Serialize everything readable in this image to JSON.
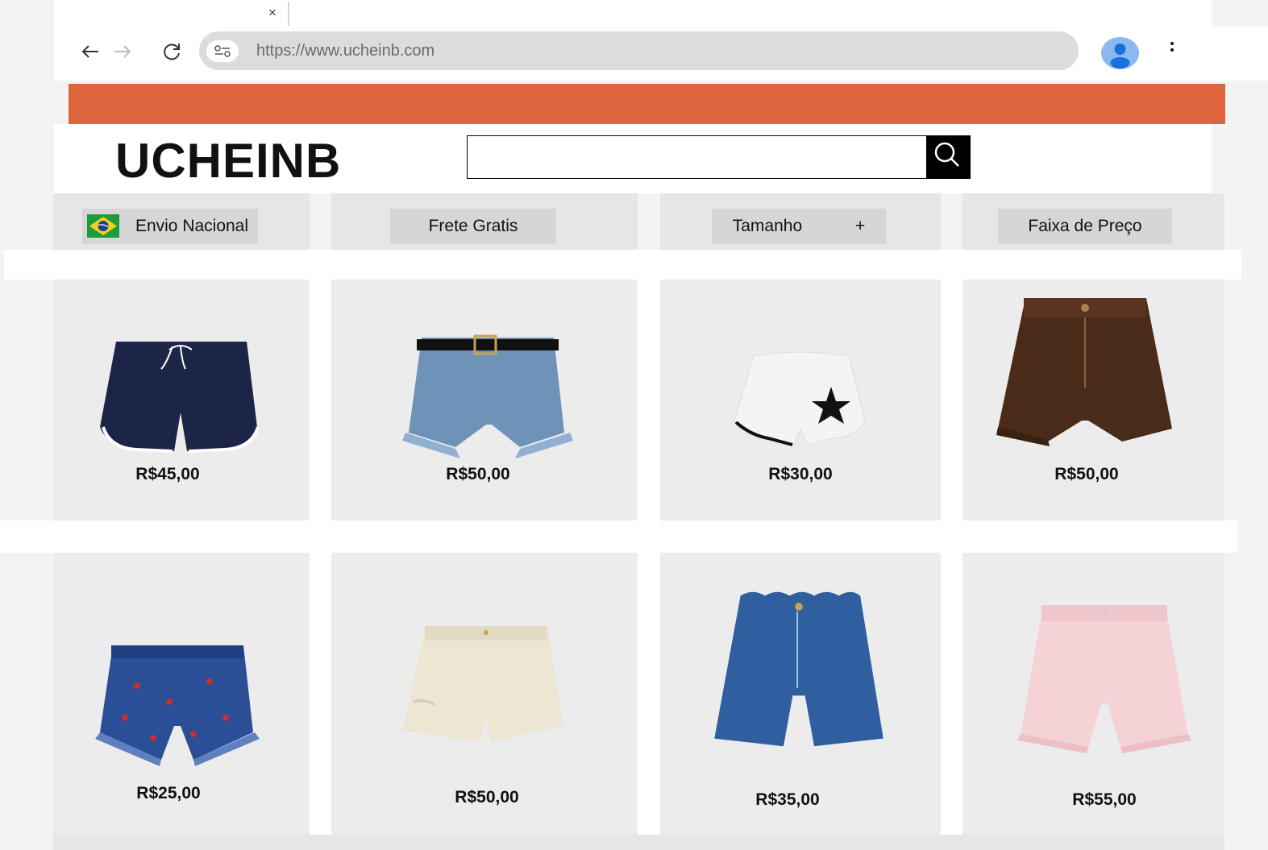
{
  "browser": {
    "url": "https://www.ucheinb.com",
    "tab_close_glyph": "×"
  },
  "site": {
    "brand": "UCHEINB",
    "banner_color": "#de643d",
    "search_placeholder": ""
  },
  "filters": [
    {
      "label": "Envio Nacional",
      "icon": "brazil-flag-icon"
    },
    {
      "label": "Frete Gratis"
    },
    {
      "label": "Tamanho",
      "suffix": "+"
    },
    {
      "label": "Faixa de Preço"
    }
  ],
  "products": [
    {
      "name": "navy-drawstring-shorts",
      "price": "R$45,00"
    },
    {
      "name": "belted-denim-shorts",
      "price": "R$50,00"
    },
    {
      "name": "white-star-shorts",
      "price": "R$30,00"
    },
    {
      "name": "brown-suede-shorts",
      "price": "R$50,00"
    },
    {
      "name": "strawberry-denim-shorts",
      "price": "R$25,00"
    },
    {
      "name": "cream-ripped-shorts",
      "price": "R$50,00"
    },
    {
      "name": "scalloped-denim-shorts",
      "price": "R$35,00"
    },
    {
      "name": "pink-high-waist-shorts",
      "price": "R$55,00"
    }
  ]
}
